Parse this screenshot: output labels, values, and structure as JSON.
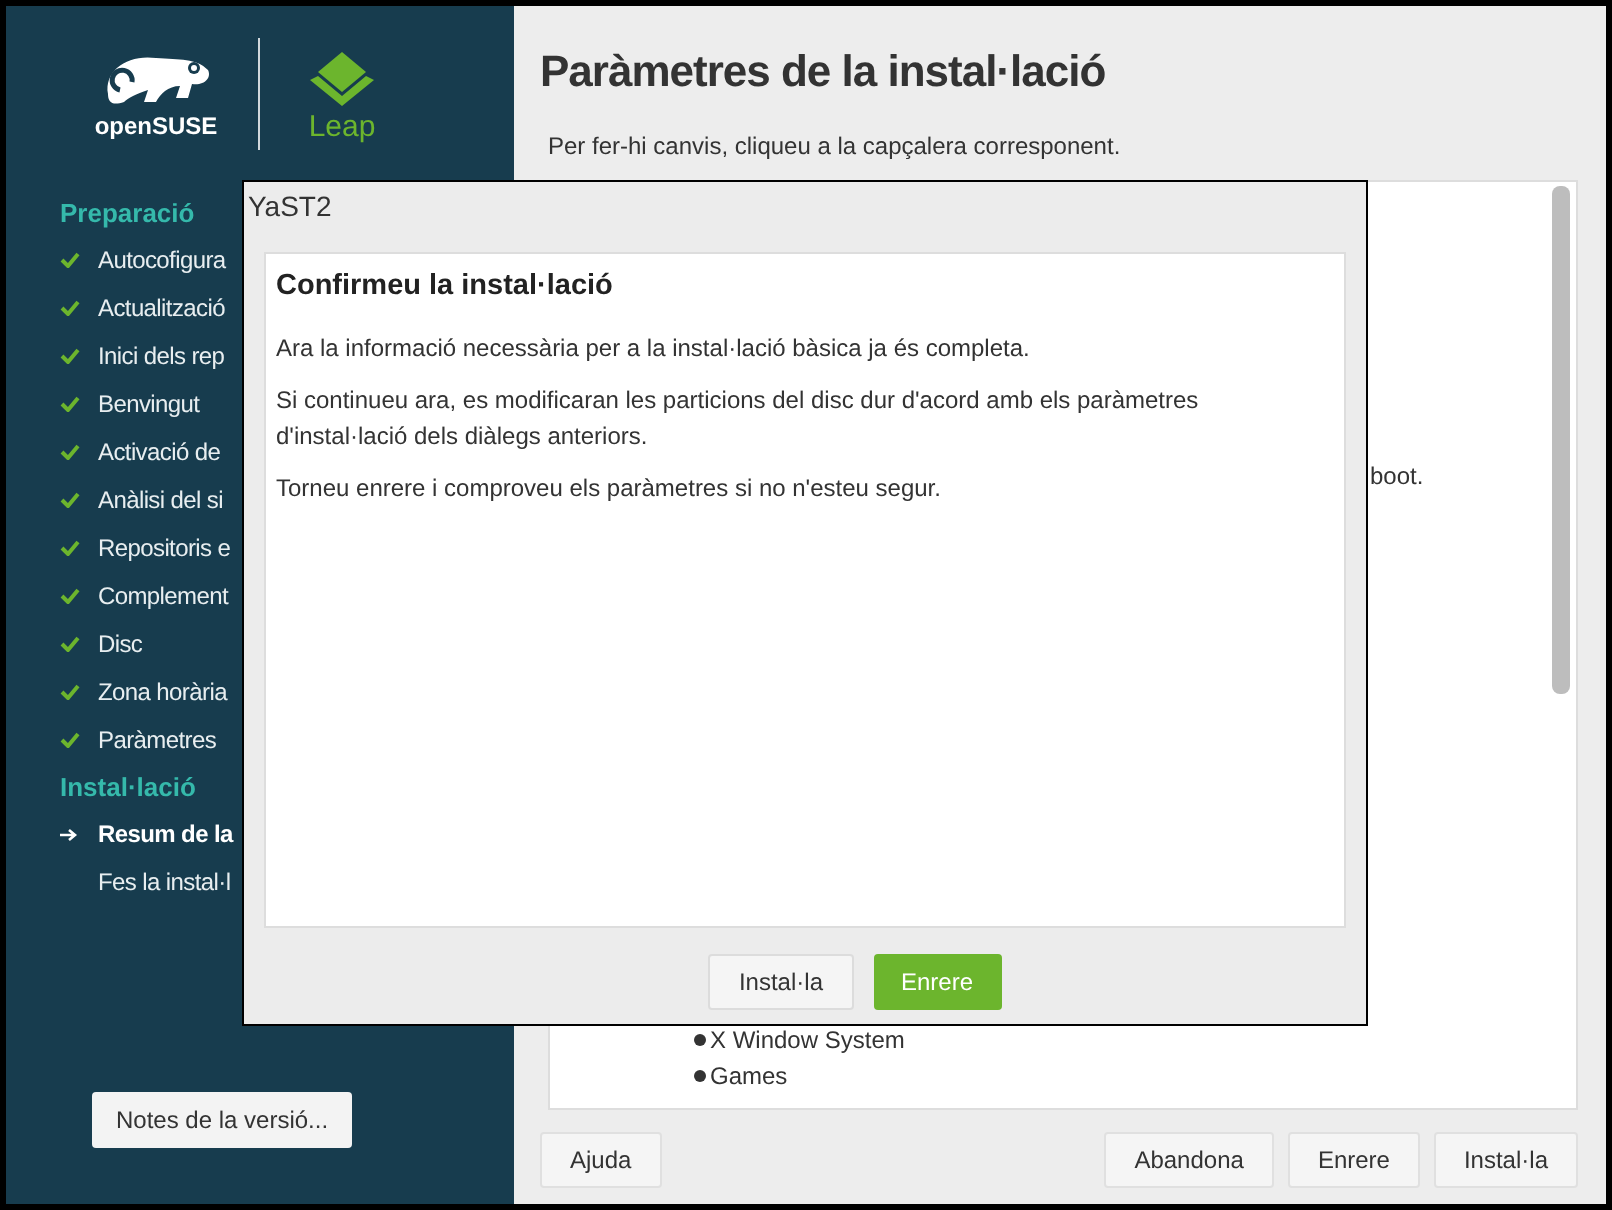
{
  "sidebar": {
    "logo_text": "openSUSE",
    "product": "Leap",
    "sections": [
      {
        "title": "Preparació",
        "steps": [
          {
            "label": "Autocofigura",
            "done": true,
            "current": false
          },
          {
            "label": "Actualització",
            "done": true,
            "current": false
          },
          {
            "label": "Inici dels rep",
            "done": true,
            "current": false
          },
          {
            "label": "Benvingut",
            "done": true,
            "current": false
          },
          {
            "label": "Activació de",
            "done": true,
            "current": false
          },
          {
            "label": "Anàlisi del si",
            "done": true,
            "current": false
          },
          {
            "label": "Repositoris e",
            "done": true,
            "current": false
          },
          {
            "label": "Complement",
            "done": true,
            "current": false
          },
          {
            "label": "Disc",
            "done": true,
            "current": false
          },
          {
            "label": "Zona horària",
            "done": true,
            "current": false
          },
          {
            "label": "Paràmetres",
            "done": true,
            "current": false
          }
        ]
      },
      {
        "title": "Instal·lació",
        "steps": [
          {
            "label": "Resum de la",
            "done": false,
            "current": true
          },
          {
            "label": "Fes la instal·l",
            "done": false,
            "current": false
          }
        ]
      }
    ],
    "release_notes_button": "Notes de la versió..."
  },
  "main": {
    "title": "Paràmetres de la instal·lació",
    "hint": "Per fer-hi canvis, cliqueu a la capçalera corresponent.",
    "summary_fragment": "boot.",
    "summary_bullets": [
      "X Window System",
      "Games"
    ]
  },
  "buttons": {
    "help": "Ajuda",
    "abort": "Abandona",
    "back": "Enrere",
    "install": "Instal·la"
  },
  "dialog": {
    "window_title": "YaST2",
    "heading": "Confirmeu la instal·lació",
    "paragraphs": [
      "Ara la informació necessària per a la instal·lació bàsica ja és completa.",
      "Si continueu ara, es modificaran les particions del disc dur d'acord amb els paràmetres d'instal·lació dels diàlegs anteriors.",
      "Torneu enrere i comproveu els paràmetres si no n'esteu segur."
    ],
    "buttons": [
      {
        "label": "Instal·la",
        "default": false
      },
      {
        "label": "Enrere",
        "default": true
      }
    ]
  }
}
